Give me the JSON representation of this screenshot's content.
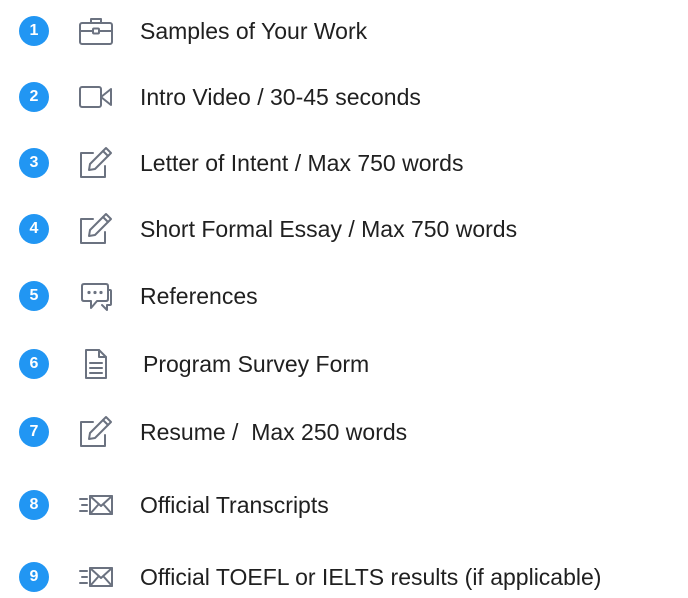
{
  "items": [
    {
      "number": "1",
      "icon": "briefcase-icon",
      "label": "Samples of Your Work"
    },
    {
      "number": "2",
      "icon": "video-camera-icon",
      "label": "Intro Video / 30-45 seconds"
    },
    {
      "number": "3",
      "icon": "edit-icon",
      "label": "Letter of Intent / Max 750 words"
    },
    {
      "number": "4",
      "icon": "edit-icon",
      "label": "Short Formal Essay / Max 750 words"
    },
    {
      "number": "5",
      "icon": "chat-bubbles-icon",
      "label": "References"
    },
    {
      "number": "6",
      "icon": "document-icon",
      "label": "Program Survey Form"
    },
    {
      "number": "7",
      "icon": "edit-icon",
      "label": "Resume /  Max 250 words"
    },
    {
      "number": "8",
      "icon": "fast-mail-icon",
      "label": "Official Transcripts"
    },
    {
      "number": "9",
      "icon": "fast-mail-icon",
      "label": "Official TOEFL or IELTS results (if applicable)"
    }
  ],
  "colors": {
    "badge": "#2196f3",
    "icon_stroke": "#6b7280",
    "text": "#202020"
  }
}
